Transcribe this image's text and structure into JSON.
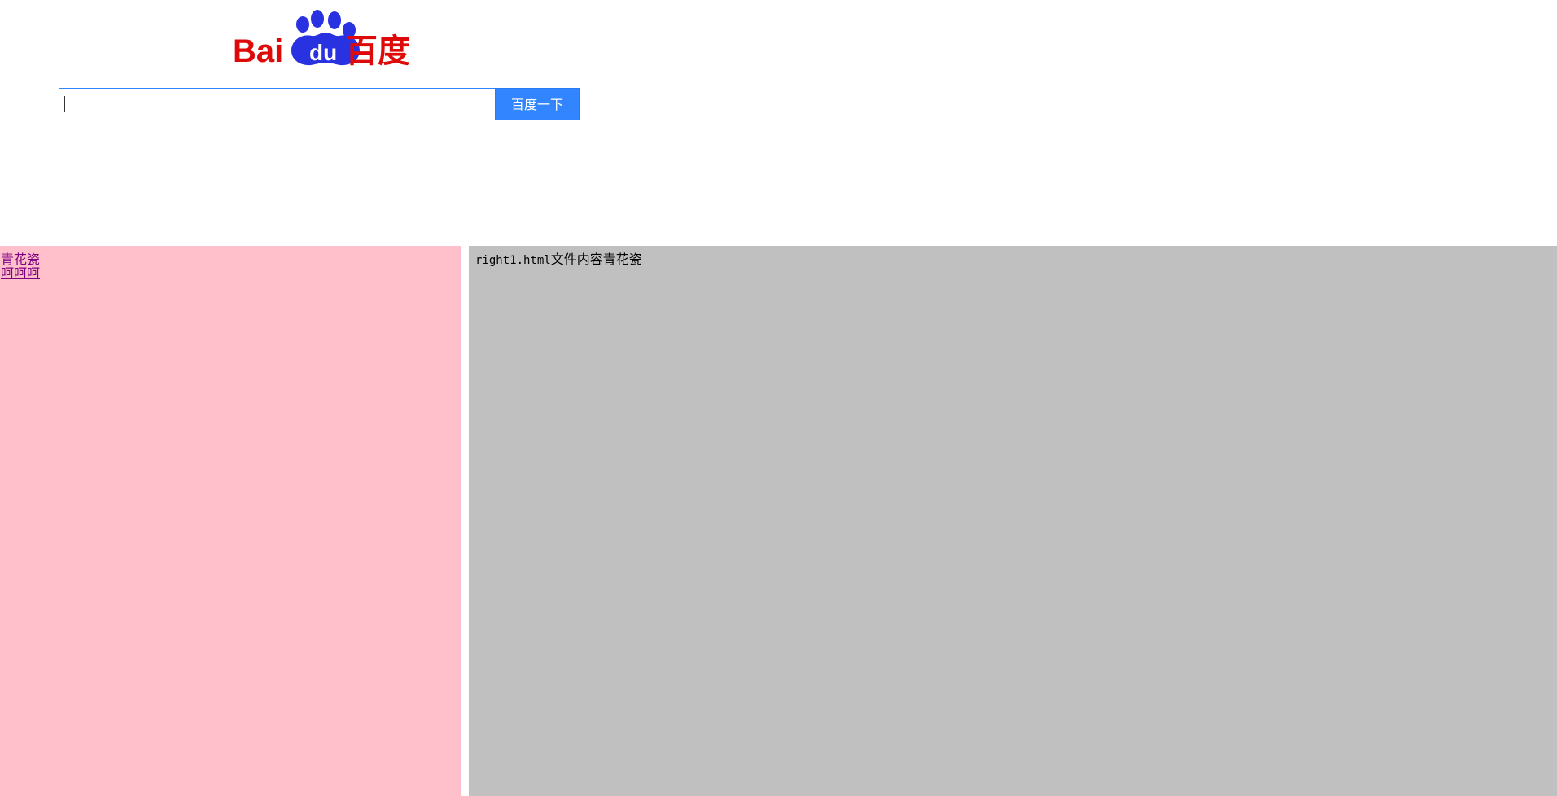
{
  "header": {
    "logo": {
      "text_left": "Bai",
      "text_mid": "du",
      "text_right": "百度",
      "colors": {
        "red": "#de0a0a",
        "blue": "#2932e1",
        "white": "#ffffff"
      }
    },
    "search": {
      "value": "",
      "placeholder": "",
      "button_label": "百度一下",
      "button_color": "#3385ff"
    }
  },
  "frames": {
    "left": {
      "background": "#ffc0cb",
      "links": [
        {
          "label": "青花瓷"
        },
        {
          "label": "呵呵呵"
        }
      ]
    },
    "right": {
      "background": "#c0c0c0",
      "content_prefix": "right1.html",
      "content_suffix": "文件内容青花瓷"
    }
  }
}
